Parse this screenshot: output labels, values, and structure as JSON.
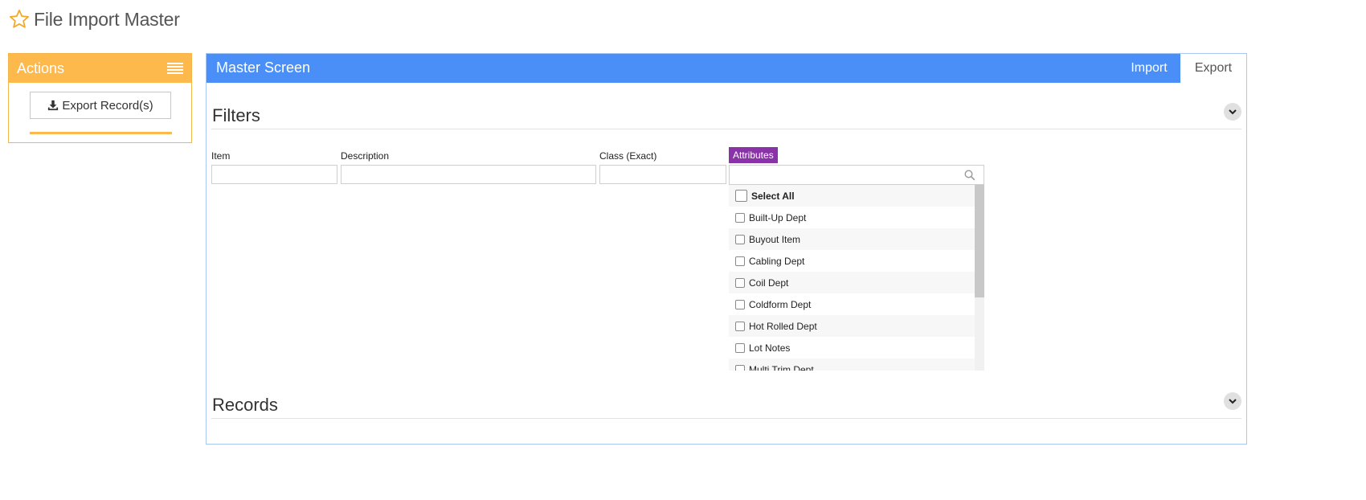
{
  "page": {
    "title": "File Import Master"
  },
  "actions": {
    "header": "Actions",
    "export_label": "Export Record(s)"
  },
  "master": {
    "title": "Master Screen",
    "tabs": [
      {
        "label": "Import",
        "active": false
      },
      {
        "label": "Export",
        "active": true
      }
    ]
  },
  "filters": {
    "title": "Filters",
    "fields": [
      {
        "label": "Item",
        "value": ""
      },
      {
        "label": "Description",
        "value": ""
      },
      {
        "label": "Class (Exact)",
        "value": ""
      }
    ],
    "attributes": {
      "label": "Attributes",
      "value": "",
      "options": [
        "Select All",
        "Built-Up Dept",
        "Buyout Item",
        "Cabling Dept",
        "Coil Dept",
        "Coldform Dept",
        "Hot Rolled Dept",
        "Lot Notes",
        "Multi Trim Dept"
      ]
    }
  },
  "records": {
    "title": "Records"
  },
  "colors": {
    "actions_accent": "#fdb94b",
    "master_accent": "#4a8ef7",
    "attributes_badge": "#8a32a7"
  },
  "icons": [
    "star-icon",
    "menu-icon",
    "download-icon",
    "chevron-down-icon",
    "search-icon"
  ]
}
